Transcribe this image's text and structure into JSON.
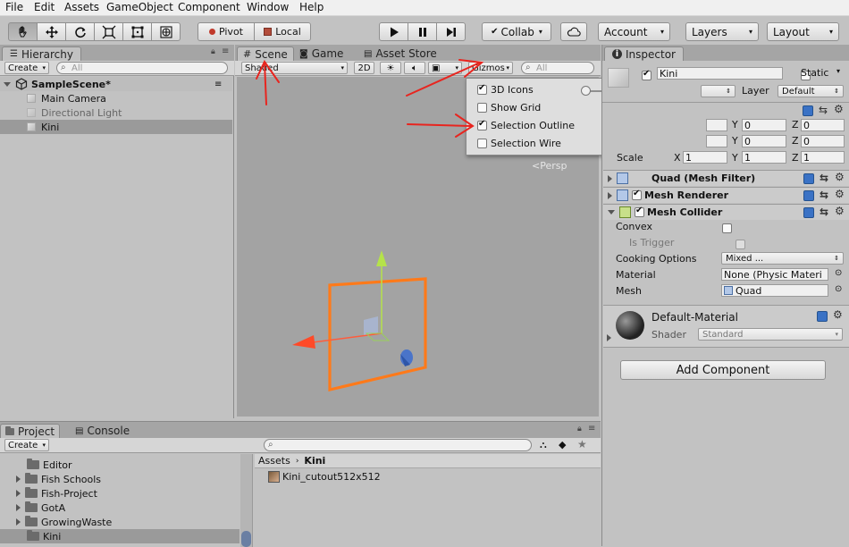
{
  "menu": [
    "File",
    "Edit",
    "Assets",
    "GameObject",
    "Component",
    "Window",
    "Help"
  ],
  "toolbar": {
    "pivot_label": "Pivot",
    "local_label": "Local",
    "collab_label": "Collab",
    "account_label": "Account",
    "layers_label": "Layers",
    "layout_label": "Layout"
  },
  "hierarchy": {
    "tab_label": "Hierarchy",
    "create_label": "Create",
    "search_placeholder": "All",
    "scene_name": "SampleScene*",
    "items": [
      "Main Camera",
      "Directional Light",
      "Kini"
    ]
  },
  "scene": {
    "tabs": [
      "Scene",
      "Game",
      "Asset Store"
    ],
    "shading": "Shaded",
    "mode_2d": "2D",
    "gizmos_label": "Gizmos",
    "search_placeholder": "All",
    "persp_label": "Persp",
    "gizmos_menu": [
      {
        "label": "3D Icons",
        "checked": true
      },
      {
        "label": "Show Grid",
        "checked": false
      },
      {
        "label": "Selection Outline",
        "checked": true
      },
      {
        "label": "Selection Wire",
        "checked": false
      }
    ]
  },
  "inspector": {
    "tab_label": "Inspector",
    "object_name": "Kini",
    "static_label": "Static",
    "layer_label": "Layer",
    "layer_value": "Default",
    "transform": {
      "scale_label": "Scale",
      "axis": [
        "X",
        "Y",
        "Z"
      ],
      "pos": [
        "",
        "0",
        "0"
      ],
      "rot": [
        "",
        "0",
        "0"
      ],
      "scale": [
        "1",
        "1",
        "1"
      ]
    },
    "components": {
      "mesh_filter": "Quad (Mesh Filter)",
      "mesh_renderer": "Mesh Renderer",
      "mesh_collider": "Mesh Collider"
    },
    "collider": {
      "convex_label": "Convex",
      "is_trigger_label": "Is Trigger",
      "cooking_label": "Cooking Options",
      "cooking_value": "Mixed ...",
      "material_label": "Material",
      "material_value": "None (Physic Materi",
      "mesh_label": "Mesh",
      "mesh_value": "Quad"
    },
    "material": {
      "name": "Default-Material",
      "shader_label": "Shader",
      "shader_value": "Standard"
    },
    "add_component_label": "Add Component"
  },
  "project": {
    "tabs": [
      "Project",
      "Console"
    ],
    "create_label": "Create",
    "folders": [
      "Editor",
      "Fish Schools",
      "Fish-Project",
      "GotA",
      "GrowingWaste",
      "Kini"
    ],
    "breadcrumb": [
      "Assets",
      "Kini"
    ],
    "assets": [
      "Kini_cutout512x512"
    ]
  },
  "colors": {
    "annotation_red": "#e8251f",
    "selection_orange": "#ff7a1a"
  }
}
